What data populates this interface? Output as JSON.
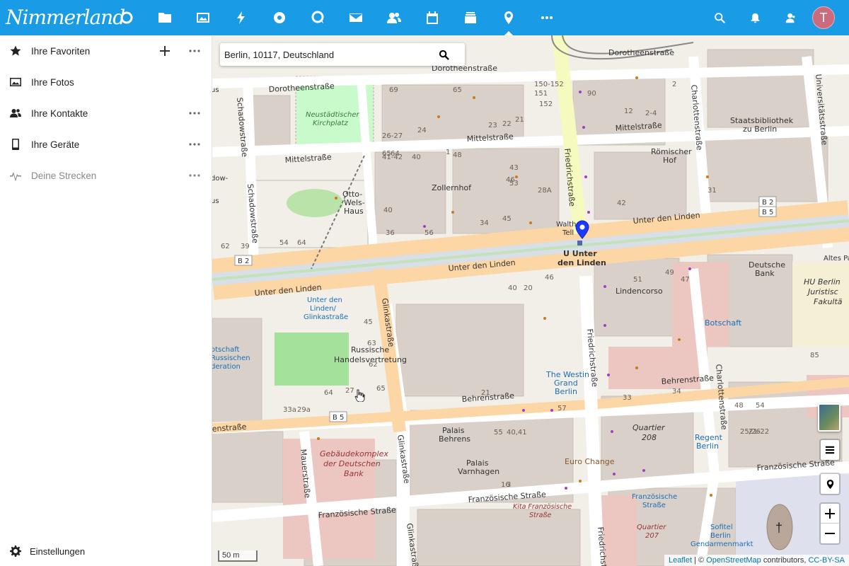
{
  "header": {
    "logo_text": "Nimmerland",
    "apps": [
      {
        "name": "dashboard-icon"
      },
      {
        "name": "files-icon"
      },
      {
        "name": "photos-icon"
      },
      {
        "name": "activity-icon"
      },
      {
        "name": "deck-icon"
      },
      {
        "name": "talk-icon"
      },
      {
        "name": "mail-icon"
      },
      {
        "name": "contacts-icon"
      },
      {
        "name": "calendar-icon"
      },
      {
        "name": "stack-icon"
      },
      {
        "name": "maps-icon",
        "active": true
      },
      {
        "name": "more-apps-icon"
      }
    ],
    "avatar_initial": "T",
    "colors": {
      "header_bg": "#1a9be6",
      "avatar_bg": "#cc6b7c"
    }
  },
  "sidebar": {
    "items": [
      {
        "label": "Ihre Favoriten",
        "icon": "star-icon"
      },
      {
        "label": "Ihre Fotos",
        "icon": "image-icon"
      },
      {
        "label": "Ihre Kontakte",
        "icon": "contacts-icon"
      },
      {
        "label": "Ihre Geräte",
        "icon": "phone-icon"
      },
      {
        "label": "Deine Strecken",
        "icon": "track-icon"
      }
    ],
    "settings_label": "Einstellungen"
  },
  "map": {
    "search_value": "Berlin, 10117, Deutschland",
    "scale_label": "50 m",
    "attribution": {
      "leaflet": "Leaflet",
      "sep": " | © ",
      "osm": "OpenStreetMap",
      "contributors": " contributors, ",
      "license": "CC-BY-SA"
    },
    "marker_label_1": "U Unter",
    "marker_label_2": "den Linden",
    "streets": {
      "unter_den_linden": "Unter den Linden",
      "unter_den_linden2": "Unter den Linden",
      "unter_den_linden3": "Unter den Linden",
      "friedrichstrasse": "Friedrichstraße",
      "friedrichstrasse2": "Friedrichstraße",
      "friedrichstrasse3": "Friedrichstraße",
      "dorotheenstrasse": "Dorotheenstraße",
      "dorotheenstrasse2": "Dorotheenstraße",
      "dorotheenstrasse3": "Dorotheenstraße",
      "mittelstrasse": "Mittelstraße",
      "mittelstrasse2": "Mittelstraße",
      "behrenstrasse": "Behrenstraße",
      "behrenstrasse2": "Behrenstraße",
      "behrenstrasse3": "enstraße",
      "franzoesische": "Französische Straße",
      "franzoesische2": "Französische Straße",
      "franzoesische3": "Französische Straße",
      "glinkastrasse": "Glinkastraße",
      "glinkastrasse2": "Glinkastraße",
      "glinkastrasse3": "Glinkastraße",
      "schadowstrasse": "Schadowstraße",
      "schadowstrasse2": "Schadowstraße",
      "charlottenstrasse": "Charlottenstraße",
      "charlottenstrasse2": "Charlottenstraße",
      "universitaetsstrasse": "Universitätsstraße",
      "mauerstrasse": "Mauerstraße"
    },
    "places": {
      "kirchplatz_1": "Neustädtischer",
      "kirchplatz_2": "Kirchplatz",
      "zollernhof": "Zollernhof",
      "otto_1": "Otto-",
      "otto_2": "Wels-",
      "otto_3": "Haus",
      "roemischer_1": "Römischer",
      "roemischer_2": "Hof",
      "staatsbib_1": "Staatsbibliothek",
      "staatsbib_2": "zu Berlin",
      "lindencorso": "Lindencorso",
      "russische_1": "Russische",
      "russische_2": "Handelsvertretung",
      "deutsche_bank_1": "Deutsche",
      "deutsche_bank_2": "Bank",
      "hu_1": "HU Berlin",
      "hu_2": "Juristisc",
      "hu_3": "Fakultä",
      "botschaft": "Botschaft",
      "westin_1": "The Westin",
      "westin_2": "Grand",
      "westin_3": "Berlin",
      "quartier208_1": "Quartier",
      "quartier208_2": "208",
      "regent_1": "Regent",
      "regent_2": "Berlin",
      "palais_behrens_1": "Palais",
      "palais_behrens_2": "Behrens",
      "palais_varnhagen_1": "Palais",
      "palais_varnhagen_2": "Varnhagen",
      "euro_change": "Euro Change",
      "gebaeude_1": "Gebäudekomplex",
      "gebaeude_2": "der Deutschen",
      "gebaeude_3": "Bank",
      "kita_1": "Kita Französische",
      "kita_2": "Straße",
      "fr_str_stop_1": "Französische",
      "fr_str_stop_2": "Straße",
      "quartier207_1": "Quartier",
      "quartier207_2": "207",
      "sofitel_1": "Sofitel",
      "sofitel_2": "Berlin",
      "sofitel_3": "Gendarmenmarkt",
      "glinka_stop_1": "Unter den",
      "glinka_stop_2": "Linden/",
      "glinka_stop_3": "Glinkastraße",
      "walther_1": "Walthe",
      "walther_2": "Tell",
      "b2": "B 2",
      "b5": "B 5",
      "b2b": "B 2",
      "b5b": "B 5",
      "b5c": "B 5",
      "russ_bot_1": "otschaft",
      "russ_bot_2": "Russischen",
      "russ_bot_3": "deration",
      "altes": "Altes Pa",
      "dow_1": "dow-",
      "dow_2": "us",
      "us": "us"
    },
    "house_numbers": [
      "69",
      "65",
      "150-152",
      "151",
      "152",
      "90",
      "26-27",
      "24",
      "23",
      "22",
      "21",
      "12",
      "2-4",
      "1",
      "65",
      "64",
      "48",
      "41-42",
      "40",
      "43",
      "53",
      "28A",
      "46",
      "42",
      "40",
      "36",
      "34",
      "45",
      "56",
      "54",
      "64",
      "62",
      "39",
      "40",
      "20",
      "46",
      "51",
      "49",
      "47",
      "45",
      "63",
      "62",
      "65",
      "64",
      "27",
      "29a",
      "33a",
      "33",
      "34",
      "48",
      "54",
      "25/26",
      "21-22",
      "21",
      "57",
      "55",
      "40,41",
      "16",
      "3",
      "85",
      "31",
      "2"
    ]
  }
}
